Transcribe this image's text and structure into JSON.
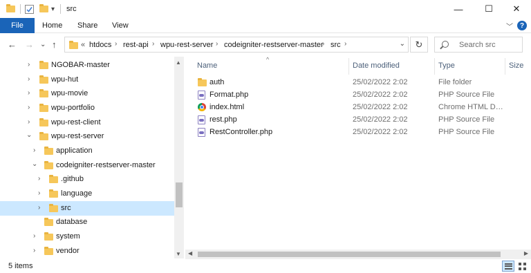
{
  "window": {
    "title": "src",
    "minimize_glyph": "—",
    "maximize_glyph": "☐",
    "close_glyph": "✕",
    "qat_dropdown_glyph": "▾"
  },
  "ribbon": {
    "tabs": [
      "File",
      "Home",
      "Share",
      "View"
    ],
    "expand_glyph": "﹀",
    "help_glyph": "?"
  },
  "navigation": {
    "back_glyph": "←",
    "forward_glyph": "→",
    "recent_glyph": "⌄",
    "up_glyph": "↑",
    "overflow_glyph": "«",
    "breadcrumb": [
      "htdocs",
      "rest-api",
      "wpu-rest-server",
      "codeigniter-restserver-master",
      "src"
    ],
    "breadcrumb_separator": "›",
    "dropdown_glyph": "⌄",
    "refresh_glyph": "↻"
  },
  "search": {
    "placeholder": "Search src"
  },
  "tree": {
    "collapsed_glyph": "›",
    "expanded_glyph": "⌄",
    "items": [
      {
        "label": "NGOBAR-master",
        "state": "collapsed"
      },
      {
        "label": "wpu-hut",
        "state": "collapsed"
      },
      {
        "label": "wpu-movie",
        "state": "collapsed"
      },
      {
        "label": "wpu-portfolio",
        "state": "collapsed"
      },
      {
        "label": "wpu-rest-client",
        "state": "collapsed"
      },
      {
        "label": "wpu-rest-server",
        "state": "expanded"
      },
      {
        "label": "application",
        "state": "collapsed"
      },
      {
        "label": "codeigniter-restserver-master",
        "state": "expanded"
      },
      {
        "label": ".github",
        "state": "collapsed"
      },
      {
        "label": "language",
        "state": "collapsed"
      },
      {
        "label": "src",
        "state": "collapsed",
        "selected": true
      },
      {
        "label": "database",
        "state": "none"
      },
      {
        "label": "system",
        "state": "collapsed"
      },
      {
        "label": "vendor",
        "state": "collapsed"
      }
    ],
    "scroll_up_glyph": "▲",
    "scroll_down_glyph": "▼"
  },
  "columns": {
    "name": "Name",
    "date": "Date modified",
    "type": "Type",
    "size": "Size",
    "sort_glyph": "^"
  },
  "files": [
    {
      "name": "auth",
      "date": "25/02/2022 2:02",
      "type": "File folder",
      "icon": "folder-icon"
    },
    {
      "name": "Format.php",
      "date": "25/02/2022 2:02",
      "type": "PHP Source File",
      "icon": "php-file-icon"
    },
    {
      "name": "index.html",
      "date": "25/02/2022 2:02",
      "type": "Chrome HTML Do...",
      "icon": "chrome-html-icon"
    },
    {
      "name": "rest.php",
      "date": "25/02/2022 2:02",
      "type": "PHP Source File",
      "icon": "php-file-icon"
    },
    {
      "name": "RestController.php",
      "date": "25/02/2022 2:02",
      "type": "PHP Source File",
      "icon": "php-file-icon"
    }
  ],
  "hscroll": {
    "left_glyph": "◀",
    "right_glyph": "▶"
  },
  "status": {
    "item_count": "5 items"
  },
  "colors": {
    "accent": "#1a64b8",
    "selection": "#cce8ff",
    "folder": "#f6c75a",
    "header_text": "#4c607a"
  }
}
